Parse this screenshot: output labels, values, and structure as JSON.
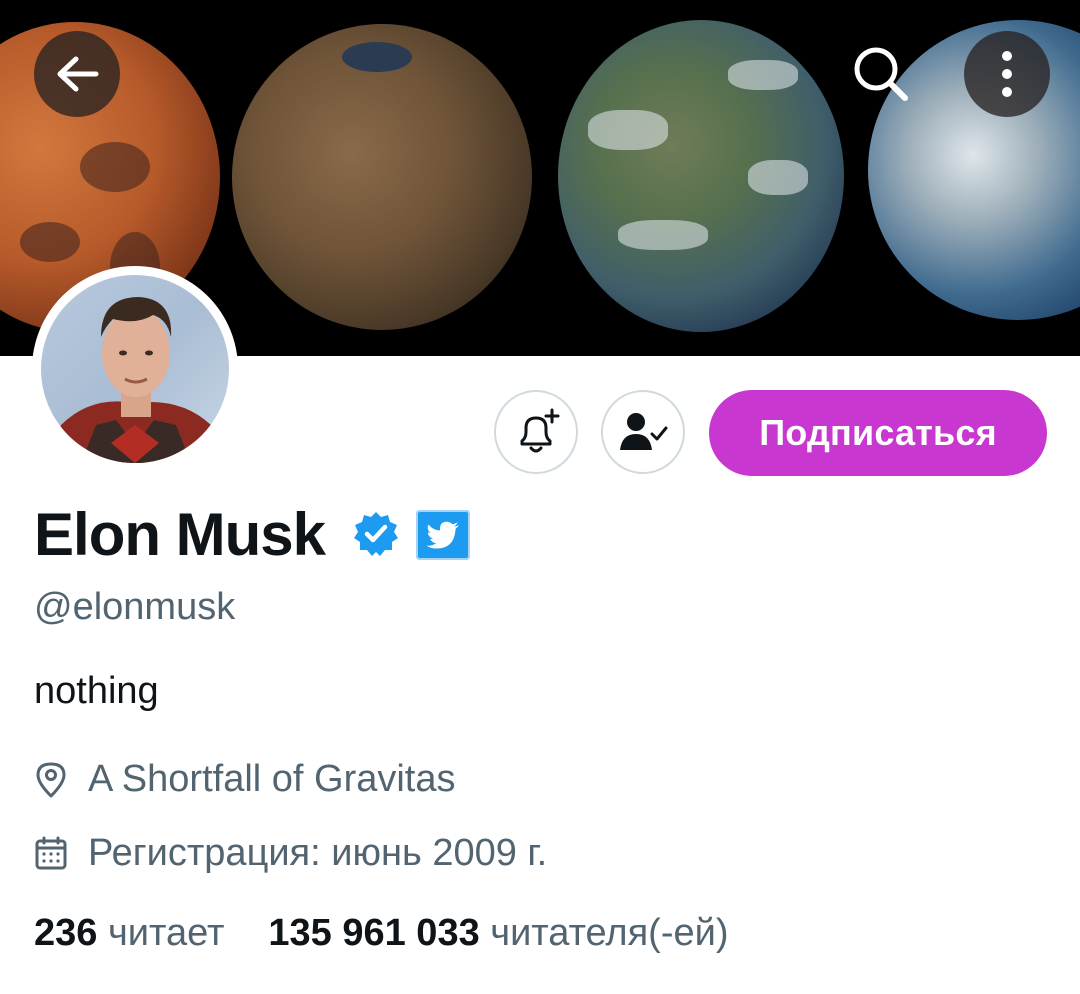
{
  "header": {
    "back_icon": "arrow-left-icon",
    "search_icon": "search-icon",
    "menu_icon": "more-vertical-icon"
  },
  "profile": {
    "name": "Elon Musk",
    "verified_badge": "verified-badge-icon",
    "affiliation_badge": "twitter-affiliation-icon",
    "handle": "@elonmusk",
    "bio": "nothing",
    "location": "A Shortfall of Gravitas",
    "joined": "Регистрация: июнь 2009 г."
  },
  "actions": {
    "notify_icon": "bell-plus-icon",
    "following_icon": "person-check-icon",
    "subscribe_label": "Подписаться"
  },
  "stats": {
    "following_count": "236",
    "following_label": "читает",
    "followers_count": "135 961 033",
    "followers_label": "читателя(-ей)"
  },
  "colors": {
    "accent": "#c837cf",
    "verified": "#1d9bf0",
    "text_primary": "#0f1419",
    "text_secondary": "#536471",
    "border": "#cfd9de"
  }
}
